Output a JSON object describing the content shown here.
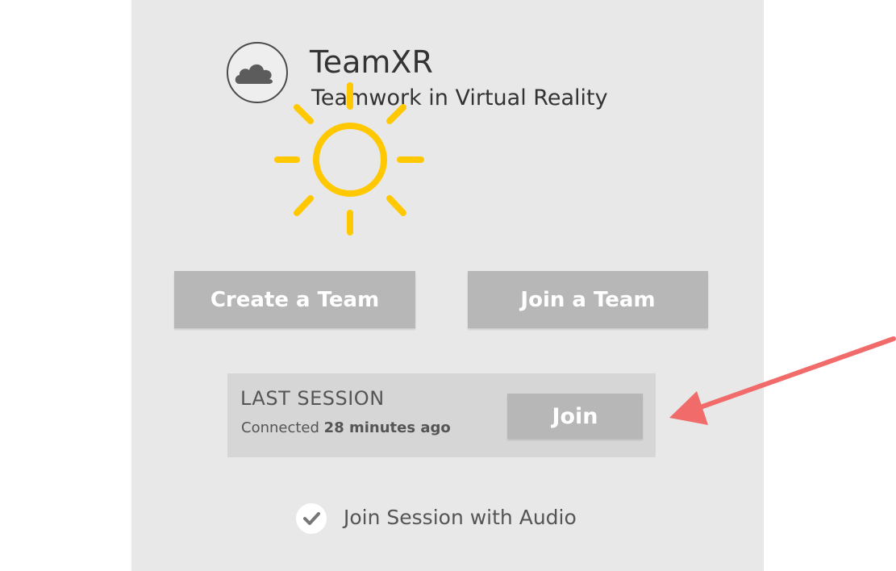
{
  "app": {
    "name": "TeamXR",
    "tagline": "Teamwork in Virtual Reality",
    "logo_icon": "cloud-icon"
  },
  "actions": {
    "create_team_label": "Create a Team",
    "join_team_label": "Join a Team"
  },
  "last_session": {
    "title": "LAST SESSION",
    "status_prefix": "Connected",
    "status_time": "28 minutes ago",
    "join_label": "Join"
  },
  "audio_option": {
    "label": "Join Session with Audio",
    "checked": true
  },
  "annotations": {
    "sun_icon": "sun-icon",
    "sun_color": "#FFC800",
    "arrow_icon": "arrow-icon",
    "arrow_color": "#F26B6B"
  },
  "colors": {
    "panel_bg": "#E8E8E8",
    "button_bg": "#B7B7B7",
    "card_bg": "#D6D6D6"
  }
}
